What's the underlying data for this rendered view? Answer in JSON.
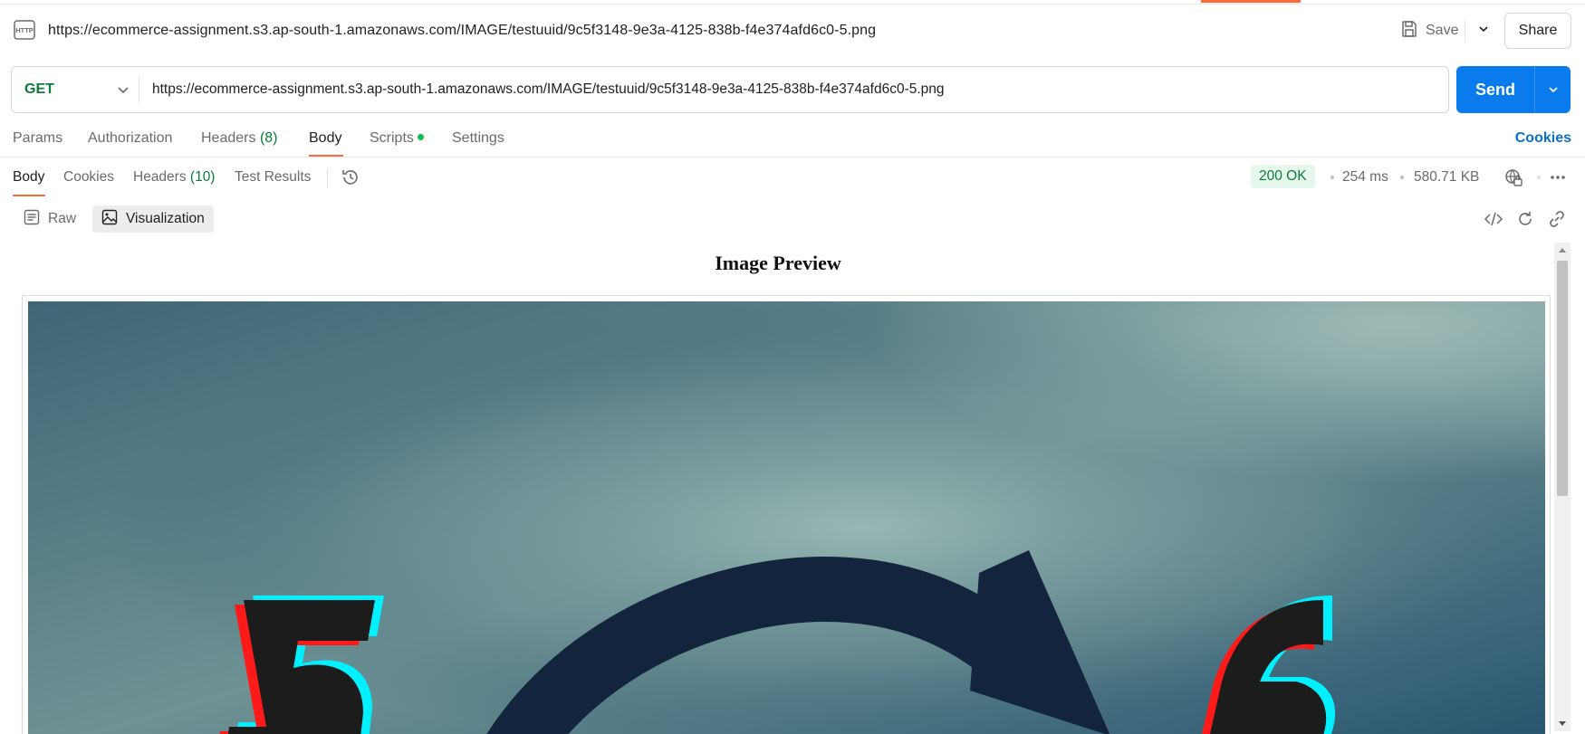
{
  "request": {
    "title": "https://ecommerce-assignment.s3.ap-south-1.amazonaws.com/IMAGE/testuuid/9c5f3148-9e3a-4125-838b-f4e374afd6c0-5.png",
    "method": "GET",
    "url": "https://ecommerce-assignment.s3.ap-south-1.amazonaws.com/IMAGE/testuuid/9c5f3148-9e3a-4125-838b-f4e374afd6c0-5.png"
  },
  "actions": {
    "save_label": "Save",
    "share_label": "Share",
    "send_label": "Send"
  },
  "request_tabs": {
    "params": "Params",
    "authorization": "Authorization",
    "headers": "Headers",
    "headers_count": "(8)",
    "body": "Body",
    "scripts": "Scripts",
    "settings": "Settings",
    "cookies": "Cookies",
    "active": "Body"
  },
  "response_tabs": {
    "body": "Body",
    "cookies": "Cookies",
    "headers": "Headers",
    "headers_count": "(10)",
    "test_results": "Test Results",
    "active": "Body"
  },
  "response_meta": {
    "status": "200 OK",
    "time": "254 ms",
    "size": "580.71 KB"
  },
  "view_modes": {
    "raw": "Raw",
    "visualization": "Visualization",
    "active": "Visualization"
  },
  "preview": {
    "title": "Image Preview"
  },
  "colors": {
    "accent": "#ff6c37",
    "send": "#097bed",
    "success": "#0b7b3e",
    "link": "#0c6ed1"
  },
  "icons": [
    "http-icon",
    "save-icon",
    "chevron-down-icon",
    "history-icon",
    "globe-lock-icon",
    "more-icon",
    "raw-icon",
    "image-icon",
    "code-icon",
    "refresh-icon",
    "link-icon"
  ]
}
